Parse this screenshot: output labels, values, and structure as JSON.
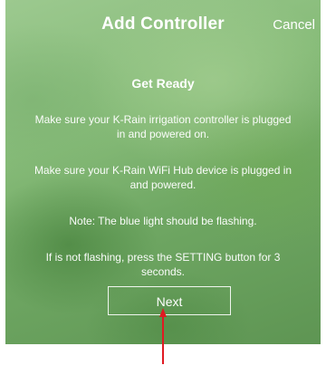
{
  "header": {
    "title": "Add Controller",
    "cancel_label": "Cancel"
  },
  "content": {
    "title": "Get Ready",
    "paragraphs": [
      "Make sure your K-Rain irrigation controller is plugged in and powered on.",
      "Make sure your K-Rain WiFi Hub device is plugged in and powered.",
      "Note: The blue light should be flashing.",
      "If is not flashing, press the SETTING button for 3 seconds."
    ]
  },
  "next_label": "Next",
  "colors": {
    "annotation_arrow": "#e01a22",
    "text": "#ffffff",
    "background_green": "#86bb78"
  },
  "icons": {
    "annotation": "up-arrow-icon"
  }
}
